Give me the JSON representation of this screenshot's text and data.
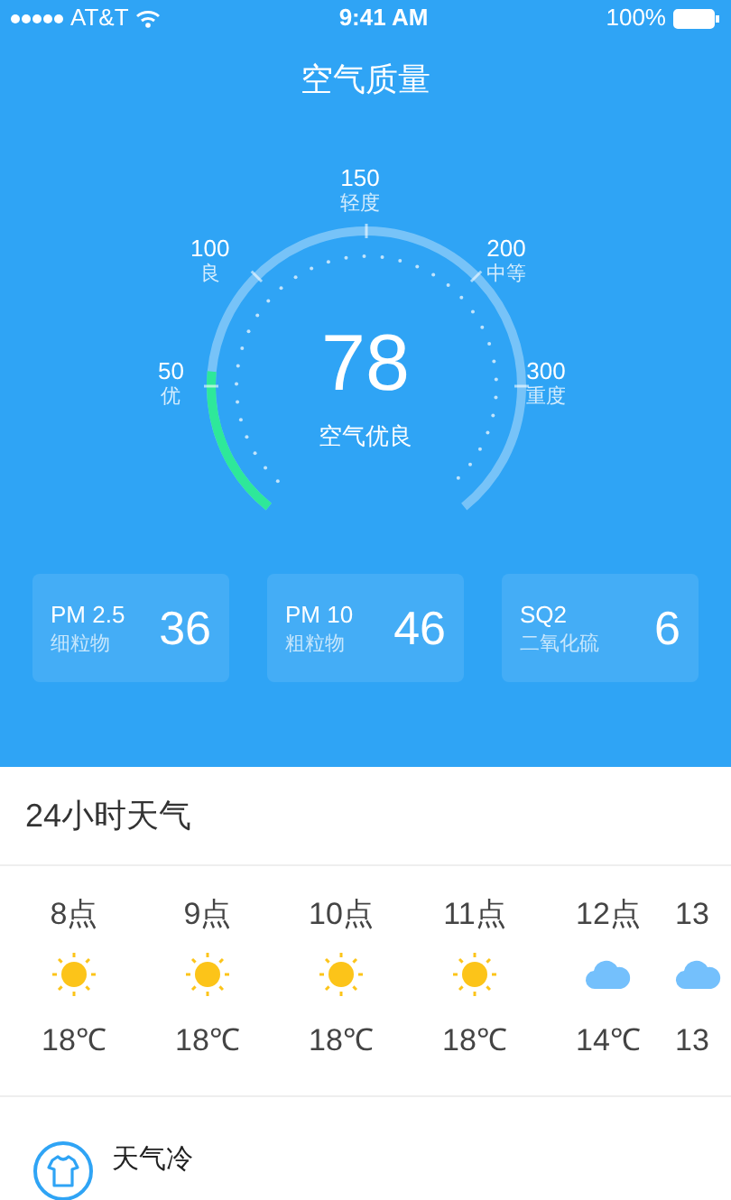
{
  "status_bar": {
    "carrier": "AT&T",
    "time": "9:41 AM",
    "battery": "100%"
  },
  "title": "空气质量",
  "gauge": {
    "value": "78",
    "label": "空气优良",
    "ticks": [
      {
        "value": "50",
        "label": "优"
      },
      {
        "value": "100",
        "label": "良"
      },
      {
        "value": "150",
        "label": "轻度"
      },
      {
        "value": "200",
        "label": "中等"
      },
      {
        "value": "300",
        "label": "重度"
      }
    ]
  },
  "pollutants": [
    {
      "name": "PM 2.5",
      "desc": "细粒物",
      "value": "36"
    },
    {
      "name": "PM 10",
      "desc": "粗粒物",
      "value": "46"
    },
    {
      "name": "SQ2",
      "desc": "二氧化硫",
      "value": "6"
    }
  ],
  "hourly": {
    "title": "24小时天气",
    "items": [
      {
        "hour": "8点",
        "kind": "sun",
        "temp": "18℃"
      },
      {
        "hour": "9点",
        "kind": "sun",
        "temp": "18℃"
      },
      {
        "hour": "10点",
        "kind": "sun",
        "temp": "18℃"
      },
      {
        "hour": "11点",
        "kind": "sun",
        "temp": "18℃"
      },
      {
        "hour": "12点",
        "kind": "cloud",
        "temp": "14℃"
      },
      {
        "hour": "13",
        "kind": "cloud",
        "temp": "13"
      }
    ]
  },
  "tip": {
    "title": "天气冷"
  }
}
